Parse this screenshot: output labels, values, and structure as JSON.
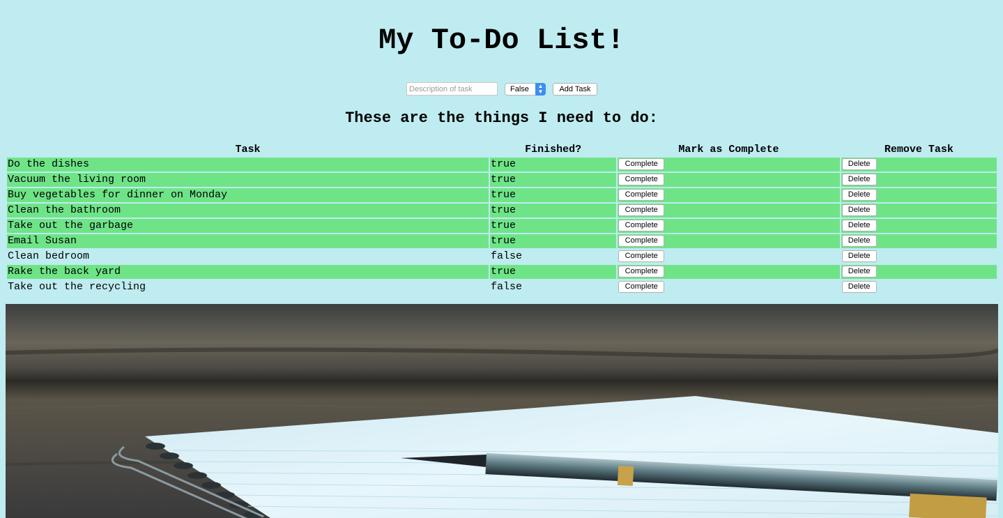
{
  "page": {
    "title": "My To-Do List!",
    "subtitle": "These are the things I need to do:"
  },
  "form": {
    "description_placeholder": "Description of task",
    "description_value": "",
    "status_selected": "False",
    "add_button_label": "Add Task"
  },
  "table": {
    "headers": {
      "task": "Task",
      "finished": "Finished?",
      "mark": "Mark as Complete",
      "remove": "Remove Task"
    },
    "rows": [
      {
        "task": "Do the dishes",
        "finished": "true",
        "complete_label": "Complete",
        "delete_label": "Delete"
      },
      {
        "task": "Vacuum the living room",
        "finished": "true",
        "complete_label": "Complete",
        "delete_label": "Delete"
      },
      {
        "task": "Buy vegetables for dinner on Monday",
        "finished": "true",
        "complete_label": "Complete",
        "delete_label": "Delete"
      },
      {
        "task": "Clean the bathroom",
        "finished": "true",
        "complete_label": "Complete",
        "delete_label": "Delete"
      },
      {
        "task": "Take out the garbage",
        "finished": "true",
        "complete_label": "Complete",
        "delete_label": "Delete"
      },
      {
        "task": "Email Susan",
        "finished": "true",
        "complete_label": "Complete",
        "delete_label": "Delete"
      },
      {
        "task": "Clean bedroom",
        "finished": "false",
        "complete_label": "Complete",
        "delete_label": "Delete"
      },
      {
        "task": "Rake the back yard",
        "finished": "true",
        "complete_label": "Complete",
        "delete_label": "Delete"
      },
      {
        "task": "Take out the recycling",
        "finished": "false",
        "complete_label": "Complete",
        "delete_label": "Delete"
      }
    ]
  },
  "colors": {
    "page_background": "#bfecf0",
    "finished_row": "#6ee487",
    "select_accent": "#3b8ff0"
  },
  "icons": {
    "select_arrows": "chevron-up-down-icon"
  }
}
